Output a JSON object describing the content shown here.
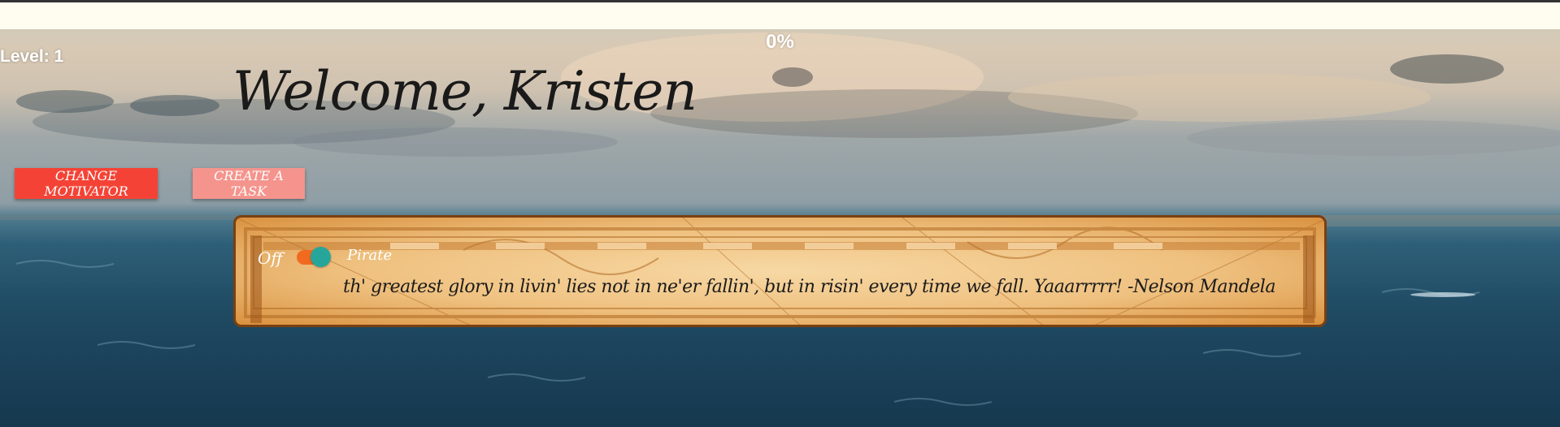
{
  "progress": {
    "percent_text": "0%",
    "value": 0
  },
  "level": {
    "label": "Level: 1"
  },
  "welcome": {
    "text": "Welcome, Kristen"
  },
  "buttons": {
    "change_motivator": "CHANGE MOTIVATOR",
    "create_task": "CREATE A TASK"
  },
  "motivator": {
    "toggle_off_label": "Off",
    "toggle_on_label": "Pirate",
    "toggle_state": "on",
    "quote": "th' greatest glory in livin' lies not in ne'er fallin', but in risin' every time we fall. Yaaarrrrr! -Nelson Mandela"
  },
  "colors": {
    "change_motivator_bg": "#f44336",
    "create_task_bg": "#f4948d",
    "toggle_track": "#f26a1f",
    "toggle_knob": "#26a69a",
    "panel_border": "#7a3f10"
  },
  "icons": {
    "toggle": "switch-toggle"
  }
}
